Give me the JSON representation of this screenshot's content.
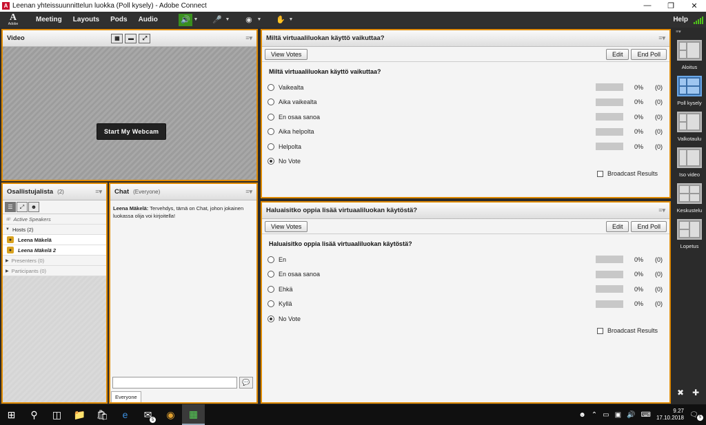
{
  "window": {
    "title": "Leenan  yhteissuunnittelun luokka (Poll kysely) - Adobe Connect"
  },
  "menubar": {
    "logo_letter": "A",
    "logo_text": "Adobe",
    "items": [
      "Meeting",
      "Layouts",
      "Pods",
      "Audio"
    ],
    "help": "Help"
  },
  "video_pod": {
    "title": "Video",
    "webcam_button": "Start My Webcam"
  },
  "poll1": {
    "title": "Miltä virtuaaliluokan käyttö vaikuttaa?",
    "view_votes": "View Votes",
    "edit": "Edit",
    "end_poll": "End Poll",
    "question": "Miltä virtuaaliluokan käyttö vaikuttaa?",
    "options": [
      {
        "label": "Vaikealta",
        "pct": "0%",
        "count": "(0)",
        "fraction": 0
      },
      {
        "label": "Aika vaikealta",
        "pct": "0%",
        "count": "(0)",
        "fraction": 0
      },
      {
        "label": "En osaa sanoa",
        "pct": "0%",
        "count": "(0)",
        "fraction": 0
      },
      {
        "label": "Aika helpolta",
        "pct": "0%",
        "count": "(0)",
        "fraction": 0
      },
      {
        "label": "Helpolta",
        "pct": "0%",
        "count": "(0)",
        "fraction": 0
      }
    ],
    "no_vote": "No Vote",
    "broadcast": "Broadcast Results"
  },
  "poll2": {
    "title": "Haluaisitko oppia lisää virtuaaliluokan käytöstä?",
    "view_votes": "View Votes",
    "edit": "Edit",
    "end_poll": "End Poll",
    "question": "Haluaisitko oppia lisää virtuaaliluokan käytöstä?",
    "options": [
      {
        "label": "En",
        "pct": "0%",
        "count": "(0)",
        "fraction": 0
      },
      {
        "label": "En osaa sanoa",
        "pct": "0%",
        "count": "(0)",
        "fraction": 0
      },
      {
        "label": "Ehkä",
        "pct": "0%",
        "count": "(0)",
        "fraction": 0
      },
      {
        "label": "Kyllä",
        "pct": "0%",
        "count": "(0)",
        "fraction": 0
      }
    ],
    "no_vote": "No Vote",
    "broadcast": "Broadcast Results"
  },
  "attendees": {
    "title": "Osallistujalista",
    "count": "(2)",
    "active_speakers": "Active Speakers",
    "hosts": "Hosts (2)",
    "host_names": [
      "Leena Mäkelä",
      "Leena Mäkelä 2"
    ],
    "presenters": "Presenters (0)",
    "participants": "Participants (0)"
  },
  "chat": {
    "title": "Chat",
    "scope": "(Everyone)",
    "sender": "Leena Mäkelä:",
    "message": "Tervehdys, tämä on Chat, johon jokainen luokassa olija voi kirjoitella!",
    "tab": "Everyone"
  },
  "layouts": [
    "Aloitus",
    "Poll kysely",
    "Valkotaulu",
    "Iso video",
    "Keskustelu",
    "Lopetus"
  ],
  "taskbar": {
    "time": "9.27",
    "date": "17.10.2018",
    "notif_count": "5",
    "mail_count": "5"
  }
}
